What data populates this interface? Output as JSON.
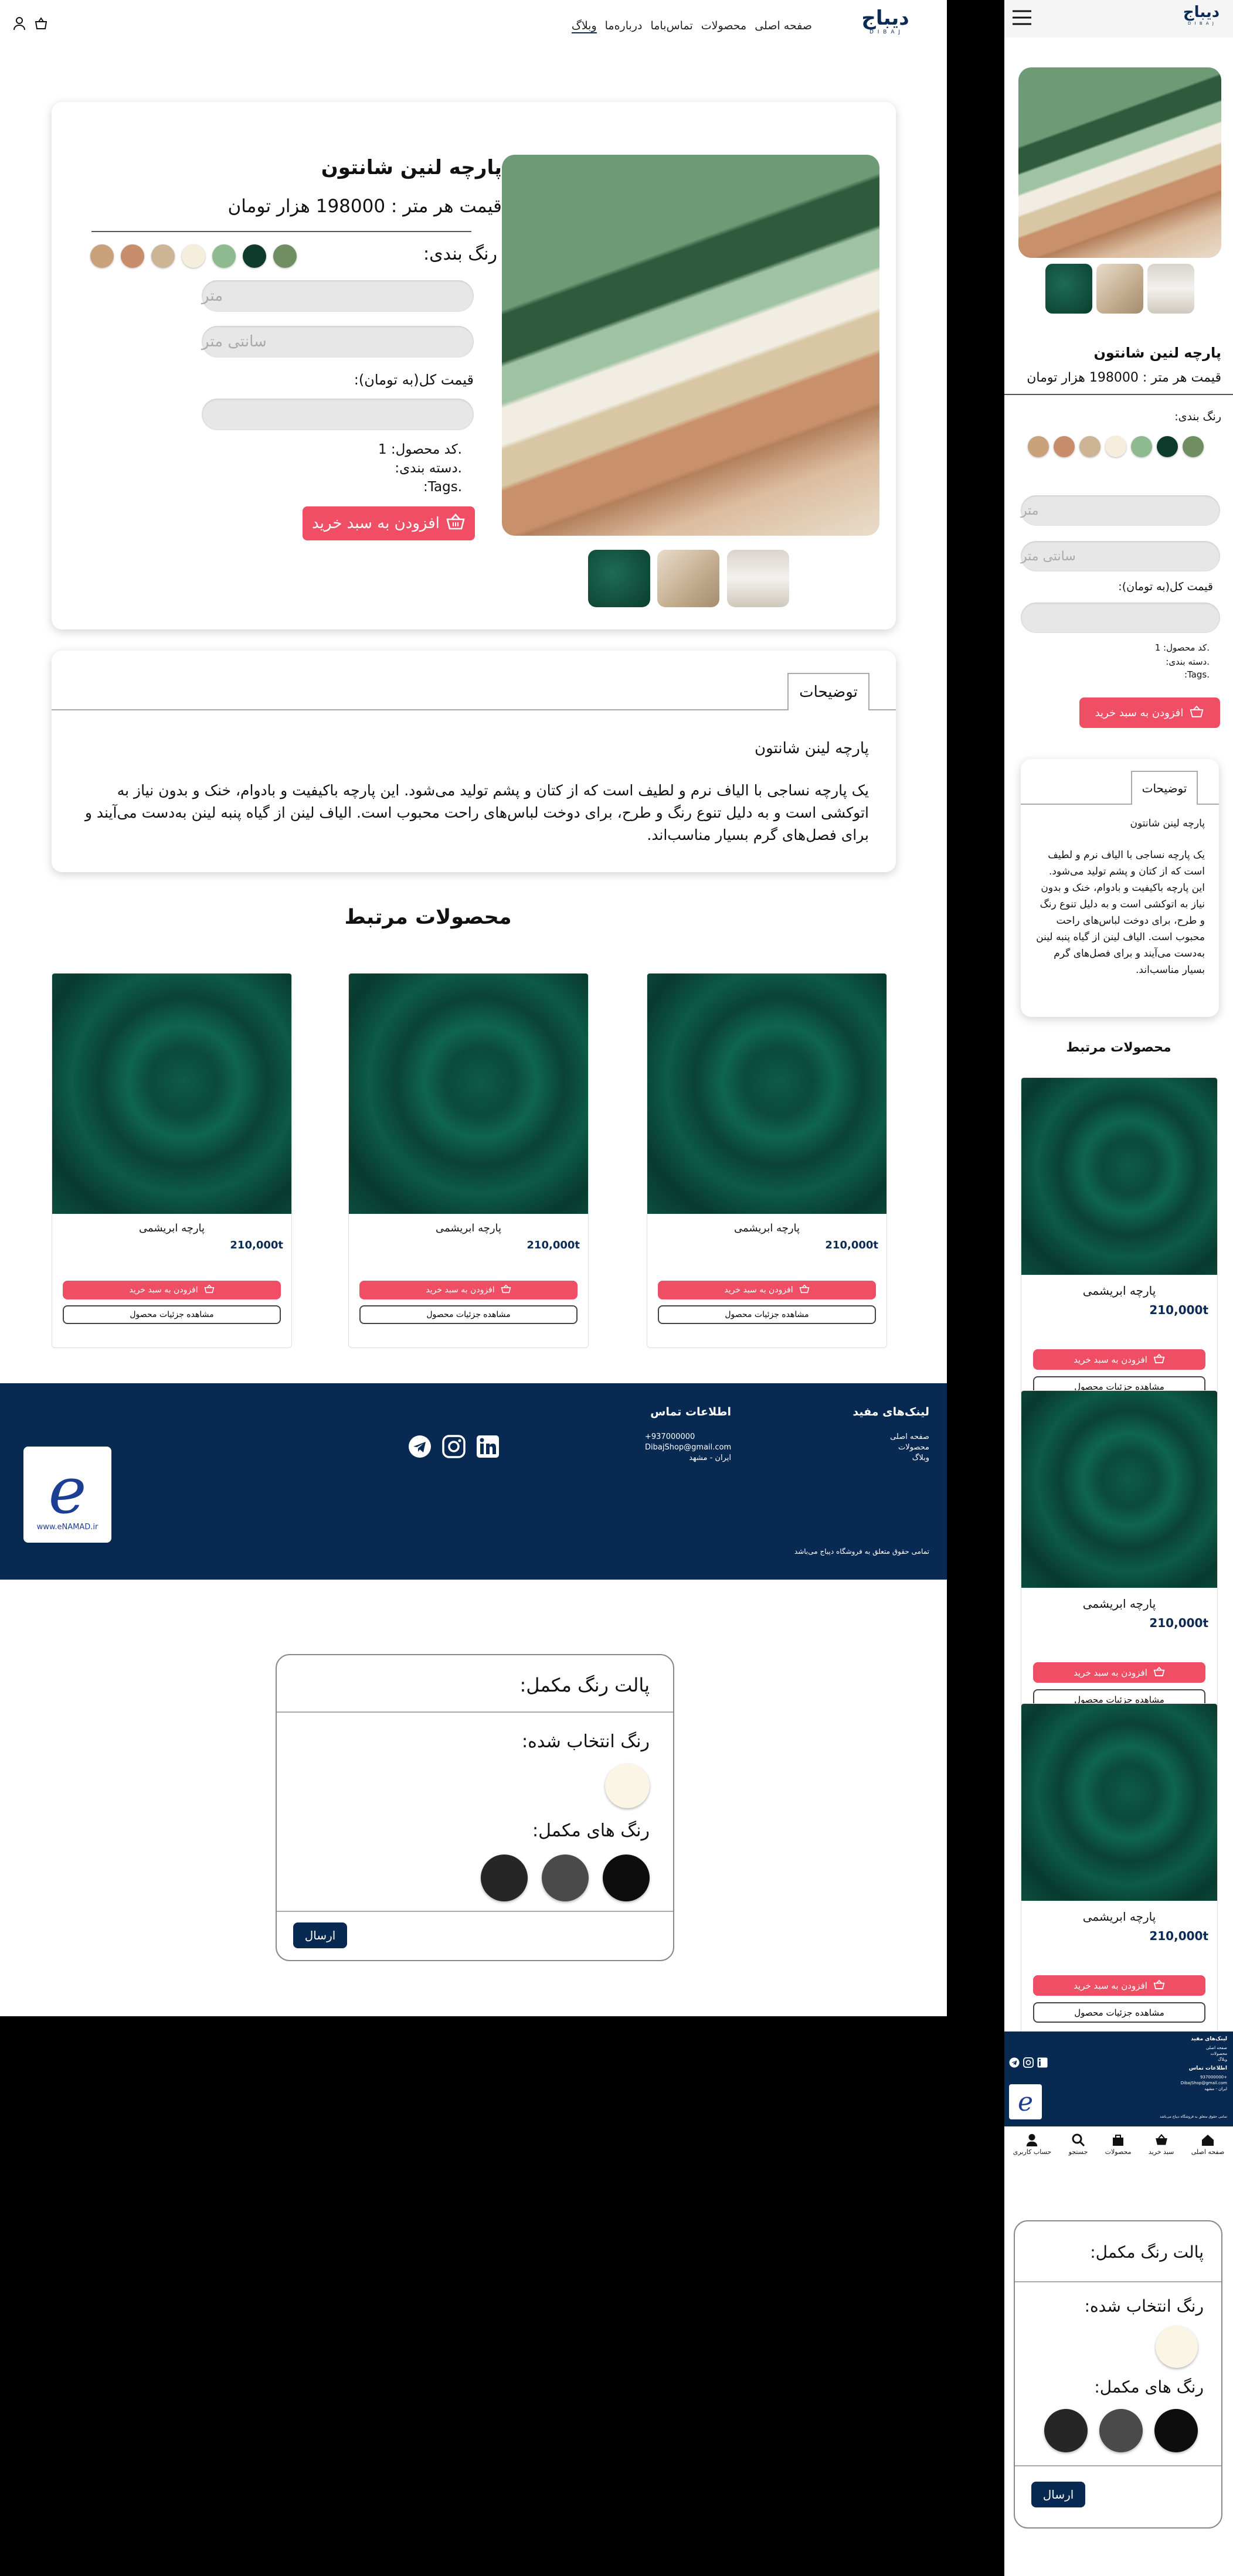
{
  "brand": {
    "logo": "دیباج",
    "sub": "D I B A J"
  },
  "nav": {
    "home": "صفحه اصلی",
    "products": "محصولات",
    "contact": "تماس‌باما",
    "about": "درباره‌ما",
    "blog": "وبلاگ"
  },
  "product": {
    "title": "پارچه لنین شانتون",
    "price": "قیمت هر متر : 198000 هزار تومان",
    "colors_label": "رنگ بندی:",
    "colors": [
      "#c9a27c",
      "#c88d6a",
      "#cdb494",
      "#f5eedc",
      "#8fb98f",
      "#0f3b2c",
      "#6f8f62"
    ],
    "meter_ph": "متر",
    "cm_ph": "سانتی متر",
    "total_label": "قیمت کل(به تومان):",
    "code": ".کد محصول: 1",
    "category": ".دسته بندی:",
    "tags": ".Tags:",
    "add_cart": "افزودن به سبد خرید"
  },
  "desc": {
    "tab": "توضیحات",
    "heading": "پارچه لینن شانتون",
    "body": "یک پارچه نساجی با الیاف نرم و لطیف است که از کتان و پشم تولید می‌شود. این پارچه باکیفیت و بادوام، خنک و بدون نیاز به اتوکشی است و به دلیل تنوع رنگ و طرح، برای دوخت لباس‌های راحت محبوب است. الیاف لینن از گیاه پنبه لینن به‌دست می‌آیند و برای فصل‌های گرم بسیار مناسب‌اند."
  },
  "related": {
    "title": "محصولات مرتبط",
    "items": [
      {
        "name": "پارچه ابریشمی",
        "price": "210,000t",
        "cart": "افزودن به سبد خرید",
        "details": "مشاهده جزئیات محصول"
      },
      {
        "name": "پارچه ابریشمی",
        "price": "210,000t",
        "cart": "افزودن به سبد خرید",
        "details": "مشاهده جزئیات محصول"
      },
      {
        "name": "پارچه ابریشمی",
        "price": "210,000t",
        "cart": "افزودن به سبد خرید",
        "details": "مشاهده جزئیات محصول"
      }
    ]
  },
  "footer": {
    "links_title": "لینک‌های مفید",
    "links": [
      "صفحه اصلی",
      "محصولات",
      "وبلاگ"
    ],
    "contact_title": "اطلاعات تماس",
    "phone": "+937000000",
    "email": "DibajShop@gmail.com",
    "address": "ایران - مشهد",
    "copyright": "تمامی حقوق متعلق به فروشگاه دیباج می‌باشد",
    "enamad": "www.eNAMAD.ir"
  },
  "palette": {
    "title": "پالت رنگ مکمل:",
    "selected_label": "رنگ انتخاب شده:",
    "selected_color": "#fbf5e6",
    "comp_label": "رنگ های مکمل:",
    "comp_colors": [
      "#262626",
      "#4a4a4a",
      "#0d0d0d"
    ],
    "submit": "ارسال"
  },
  "bottom_nav": {
    "home": "صفحه اصلی",
    "cart": "سبد خرید",
    "products": "محصولات",
    "search": "جستجو",
    "account": "حساب کاربری"
  }
}
